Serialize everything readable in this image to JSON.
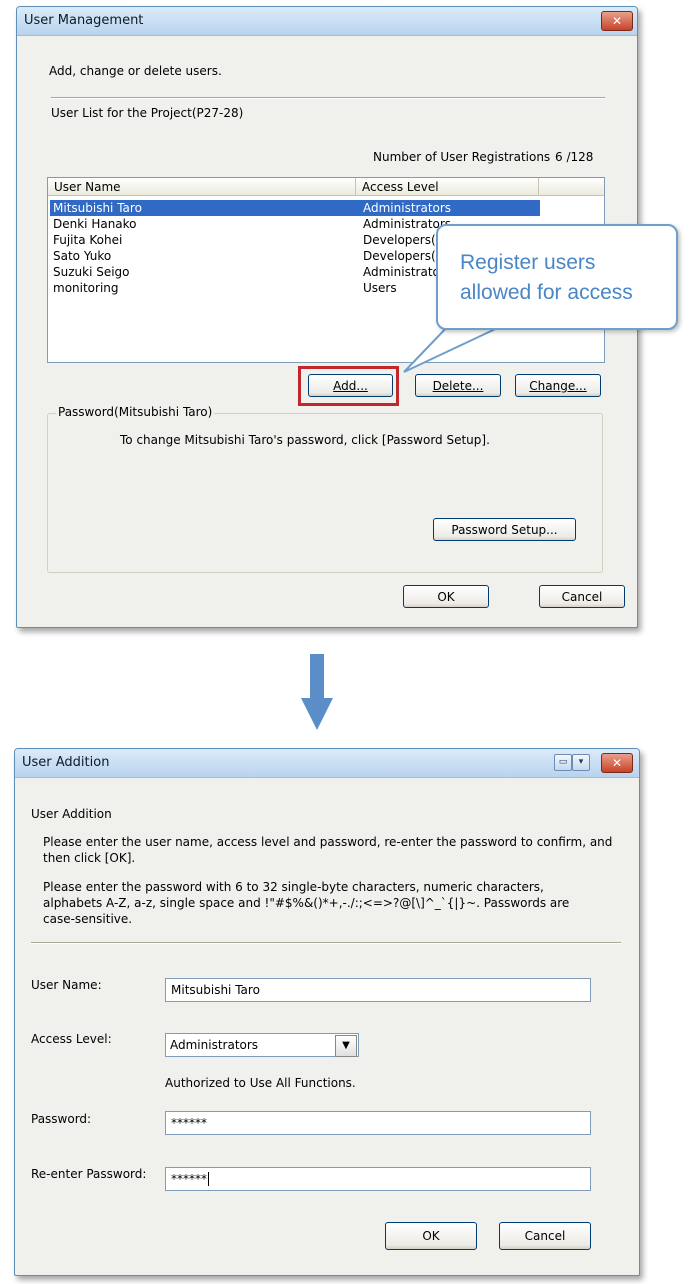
{
  "user_management": {
    "title": "User Management",
    "close": "✕",
    "intro": "Add, change or delete users.",
    "list_title": "User List for the Project(P27-28)",
    "registrations_label": "Number of User Registrations",
    "registrations_value": "6  /128",
    "columns": [
      "User Name",
      "Access Level"
    ],
    "users": [
      {
        "name": "Mitsubishi Taro",
        "level": "Administrators"
      },
      {
        "name": "Denki Hanako",
        "level": "Administrators"
      },
      {
        "name": "Fujita Kohei",
        "level": "Developers(Le"
      },
      {
        "name": "Sato Yuko",
        "level": "Developers(Le"
      },
      {
        "name": "Suzuki Seigo",
        "level": "Administrator"
      },
      {
        "name": "monitoring",
        "level": "Users"
      }
    ],
    "add_button": "Add...",
    "delete_button": "Delete...",
    "change_button": "Change...",
    "password_group": "Password(Mitsubishi Taro)",
    "password_hint": "To change Mitsubishi Taro's password, click [Password Setup].",
    "password_setup_button": "Password Setup...",
    "ok_button": "OK",
    "cancel_button": "Cancel"
  },
  "callout": {
    "text": "Register users allowed for access",
    "border_color": "#6f9ecb",
    "text_color": "#4a86c5"
  },
  "highlight_color": "#c1272d",
  "arrow_color": "#5b8ec8",
  "user_addition": {
    "title": "User Addition",
    "heading": "User Addition",
    "instruction1": "Please enter the user name, access level and password, re-enter the password to confirm, and then click [OK].",
    "instruction2": "Please enter the password with 6 to 32 single-byte characters, numeric characters, alphabets A-Z, a-z, single space and  !\"#$%&()*+,-./:;<=>?@[\\]^_`{|}~. Passwords are case-sensitive.",
    "user_name_label": "User Name:",
    "user_name_value": "Mitsubishi Taro",
    "access_level_label": "Access Level:",
    "access_level_value": "Administrators",
    "access_level_desc": "Authorized to Use All Functions.",
    "password_label": "Password:",
    "password_value": "******",
    "reenter_label": "Re-enter Password:",
    "reenter_value": "******",
    "ok_button": "OK",
    "cancel_button": "Cancel"
  }
}
